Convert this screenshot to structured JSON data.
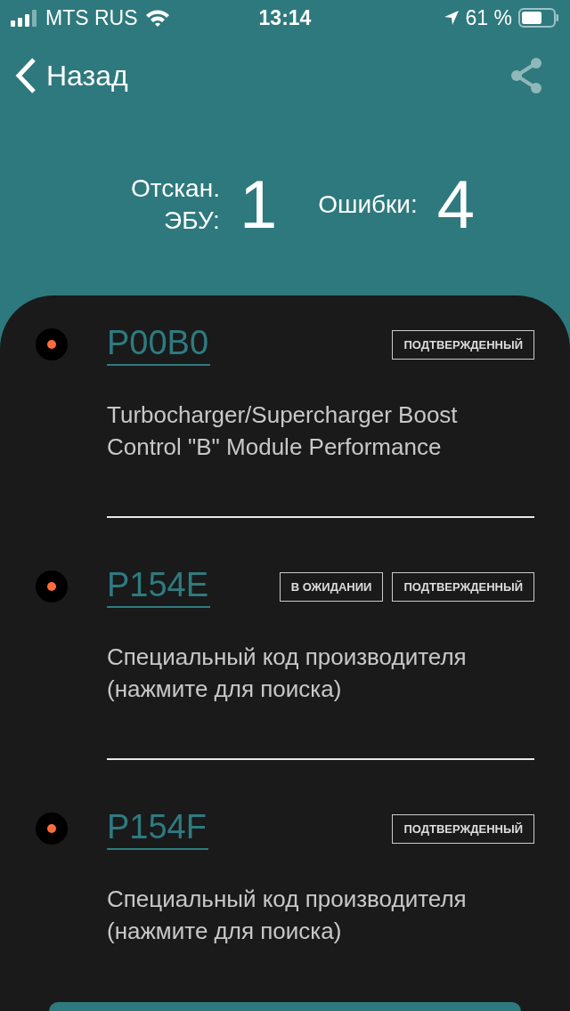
{
  "status_bar": {
    "carrier": "MTS RUS",
    "time": "13:14",
    "battery": "61 %"
  },
  "nav": {
    "back": "Назад"
  },
  "summary": [
    {
      "label": "Отскан.\nЭБУ:",
      "value": "1"
    },
    {
      "label": "Ошибки:",
      "value": "4"
    }
  ],
  "errors": [
    {
      "code": "P00B0",
      "tags": [
        "ПОДТВЕРЖДЕННЫЙ"
      ],
      "description": "Turbocharger/Supercharger Boost Control \"B\" Module Performance"
    },
    {
      "code": "P154E",
      "tags": [
        "В ОЖИДАНИИ",
        "ПОДТВЕРЖДЕННЫЙ"
      ],
      "description": "Специальный код производителя (нажмите для поиска)"
    },
    {
      "code": "P154F",
      "tags": [
        "ПОДТВЕРЖДЕННЫЙ"
      ],
      "description": "Специальный код производителя (нажмите для поиска)"
    }
  ]
}
